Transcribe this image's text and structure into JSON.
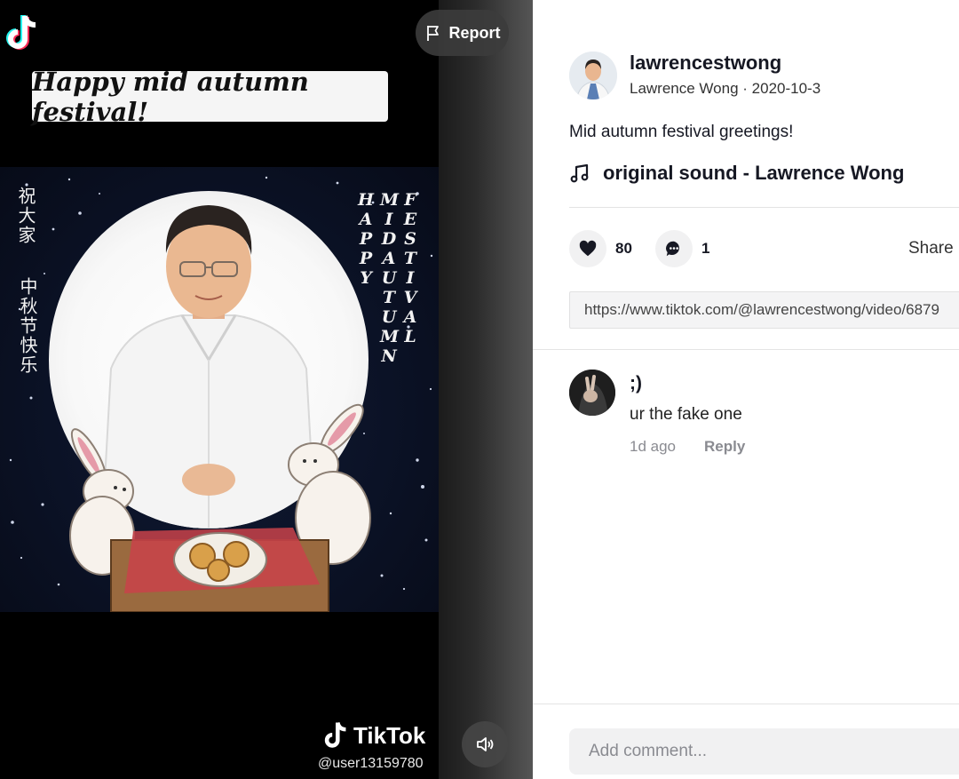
{
  "player": {
    "report_label": "Report",
    "banner_text": "Happy mid autumn festival!",
    "greeting_cn_1": "祝大家",
    "greeting_cn_2": "中秋节快乐",
    "vertical_en": [
      "HAPPY",
      "MIDAUTUMN",
      "FESTIVAL"
    ],
    "watermark_brand": "TikTok",
    "watermark_user": "@user13159780"
  },
  "post": {
    "username": "lawrencestwong",
    "display_name": "Lawrence Wong",
    "date": "2020-10-3",
    "caption": "Mid autumn festival greetings!",
    "music": "original sound - Lawrence Wong",
    "likes": "80",
    "comments": "1",
    "share_label": "Share",
    "link": "https://www.tiktok.com/@lawrencestwong/video/6879"
  },
  "comments": [
    {
      "name": ";)",
      "text": "ur the fake one",
      "time": "1d ago",
      "reply_label": "Reply"
    }
  ],
  "comment_input": {
    "placeholder": "Add comment..."
  },
  "colors": {
    "tiktok_cyan": "#25f4ee",
    "tiktok_red": "#fe2c55",
    "panel_bg": "#ffffff"
  }
}
